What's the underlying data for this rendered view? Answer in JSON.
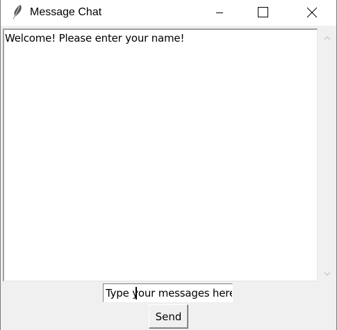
{
  "window": {
    "title": "Message Chat",
    "icon": "feather-icon",
    "controls": [
      "minimize-icon",
      "maximize-icon",
      "close-icon"
    ]
  },
  "chat": {
    "messages": [
      "Welcome! Please enter your name!"
    ]
  },
  "scrollbar": {
    "up_icon": "chevron-up-icon",
    "down_icon": "chevron-down-icon"
  },
  "entry": {
    "value": "Type your messages here"
  },
  "send_label": "Send"
}
